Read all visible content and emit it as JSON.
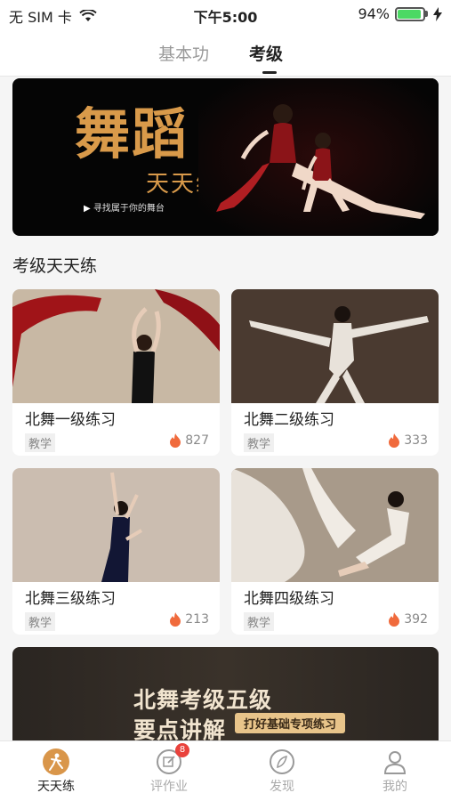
{
  "status_bar": {
    "carrier": "无 SIM 卡",
    "time": "下午5:00",
    "battery": "94%",
    "battery_level": 0.94
  },
  "top_tabs": {
    "tab1": "基本功",
    "tab2": "考级",
    "active": "考级"
  },
  "hero": {
    "title_main": "舞蹈",
    "title_sub": "天天练",
    "subtitle": "寻找属于你的舞台"
  },
  "section": {
    "title": "考级天天练"
  },
  "cards": [
    {
      "title": "北舞一级练习",
      "badge": "教学",
      "count": "827"
    },
    {
      "title": "北舞二级练习",
      "badge": "教学",
      "count": "333"
    },
    {
      "title": "北舞三级练习",
      "badge": "教学",
      "count": "213"
    },
    {
      "title": "北舞四级练习",
      "badge": "教学",
      "count": "392"
    }
  ],
  "bottom_banner": {
    "line1": "北舞考级五级",
    "line2": "要点讲解",
    "tag": "打好基础专项练习"
  },
  "bottom_nav": {
    "items": [
      {
        "label": "天天练",
        "icon": "dancer-icon",
        "active": true
      },
      {
        "label": "评作业",
        "icon": "edit-icon",
        "badge": "8"
      },
      {
        "label": "发现",
        "icon": "compass-icon"
      },
      {
        "label": "我的",
        "icon": "person-icon"
      }
    ]
  },
  "colors": {
    "accent": "#d99a4a",
    "hot": "#f06a3c",
    "badge": "#e9423c"
  }
}
